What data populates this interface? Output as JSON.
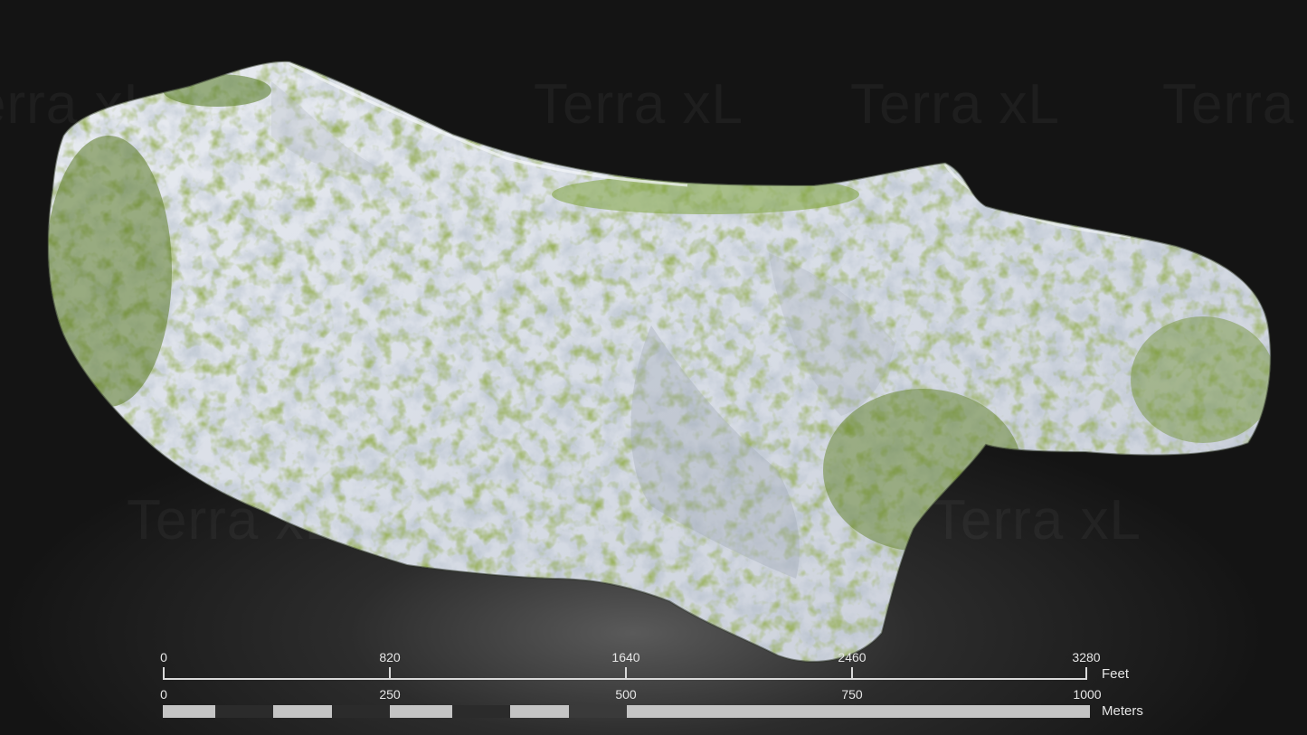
{
  "watermark": {
    "text": "Terra xL"
  },
  "scale_bar": {
    "feet": {
      "ticks": [
        "0",
        "820",
        "1640",
        "2460",
        "3280"
      ],
      "unit": "Feet"
    },
    "meters": {
      "ticks": [
        "0",
        "250",
        "500",
        "750",
        "1000"
      ],
      "unit": "Meters"
    }
  },
  "colors": {
    "background": "#151515",
    "rock": "#dfe3ea",
    "vegetation": "#6f8f2e",
    "scale_light": "#c4c4c4",
    "scale_dark": "#2b2b2b"
  }
}
